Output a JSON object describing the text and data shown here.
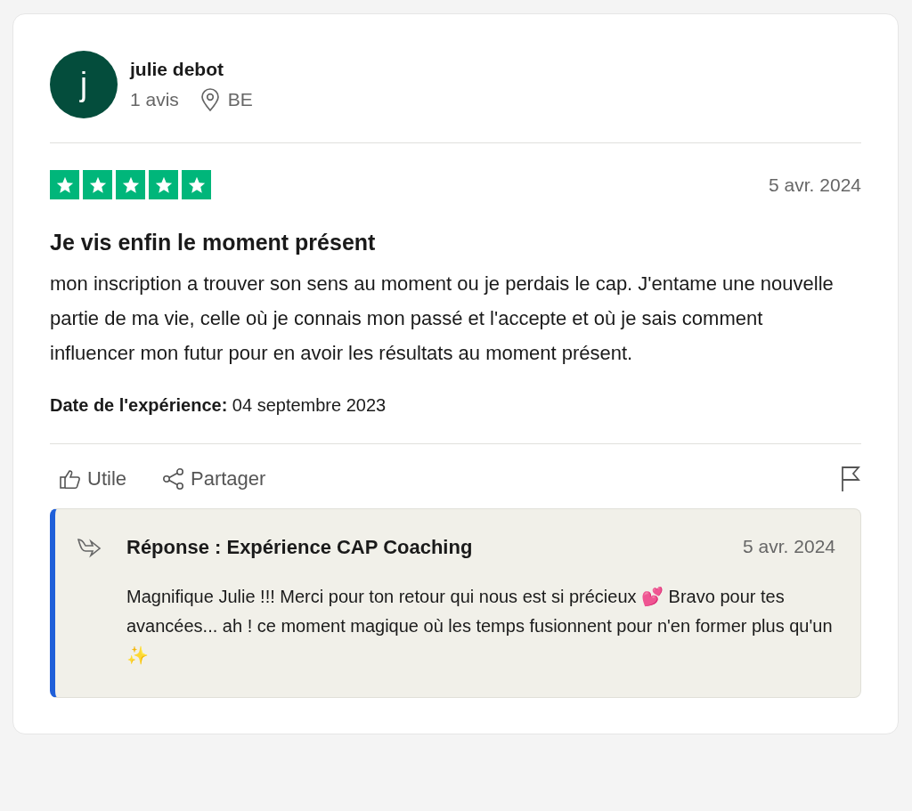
{
  "reviewer": {
    "avatar_letter": "j",
    "name": "julie debot",
    "review_count": "1 avis",
    "country": "BE"
  },
  "review": {
    "stars": 5,
    "date": "5 avr. 2024",
    "title": "Je vis enfin le moment présent",
    "body": "mon inscription a trouver son sens au moment ou je perdais le cap. J'entame une nouvelle partie de ma vie, celle où je connais mon passé et l'accepte et où je sais comment influencer mon futur pour en avoir les résultats au moment présent.",
    "experience_label": "Date de l'expérience:",
    "experience_date": "04 septembre 2023"
  },
  "actions": [
    {
      "kind": "like",
      "label": "Utile"
    },
    {
      "kind": "share",
      "label": "Partager"
    },
    {
      "kind": "flag"
    }
  ],
  "reply": {
    "title": "Réponse : Expérience CAP Coaching",
    "date": "5 avr. 2024",
    "body": "Magnifique Julie !!! Merci pour ton retour qui nous est si précieux 💕 Bravo pour tes avancées... ah ! ce moment magique où les temps fusionnent pour n'en former plus qu'un ✨"
  }
}
